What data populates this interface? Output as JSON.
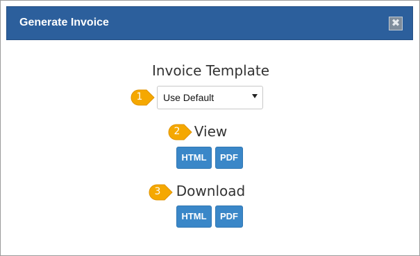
{
  "dialog": {
    "title": "Generate Invoice",
    "close_glyph": "✖"
  },
  "template_section": {
    "heading": "Invoice Template",
    "selected_value": "Use Default"
  },
  "view_section": {
    "heading": "View",
    "html_label": "HTML",
    "pdf_label": "PDF"
  },
  "download_section": {
    "heading": "Download",
    "html_label": "HTML",
    "pdf_label": "PDF"
  },
  "markers": [
    "1",
    "2",
    "3"
  ],
  "colors": {
    "header": "#2c5f9c",
    "button": "#3a87c8",
    "marker": "#f5a800"
  }
}
